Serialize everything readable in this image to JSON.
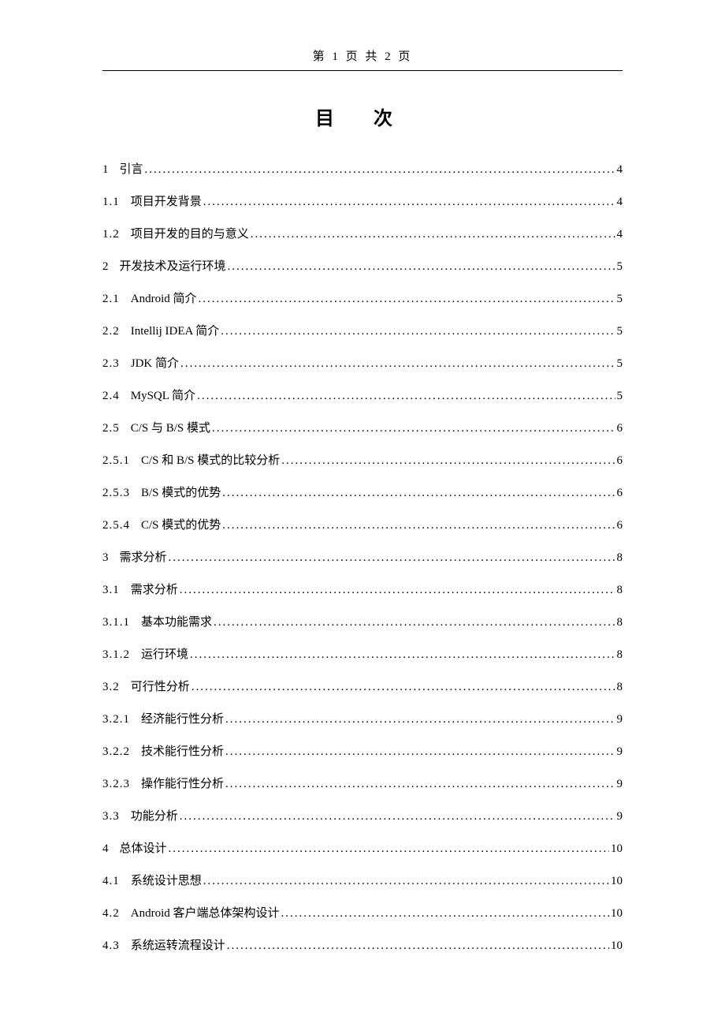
{
  "header": {
    "text": "第 1 页 共 2 页"
  },
  "title": "目  次",
  "toc": [
    {
      "level": 1,
      "num": "1",
      "label": "引言",
      "page": "4"
    },
    {
      "level": 2,
      "num": "1.1",
      "label": "项目开发背景",
      "page": "4"
    },
    {
      "level": 2,
      "num": "1.2",
      "label": "项目开发的目的与意义",
      "page": "4"
    },
    {
      "level": 1,
      "num": "2",
      "label": "开发技术及运行环境",
      "page": "5"
    },
    {
      "level": 2,
      "num": "2.1",
      "label": "Android 简介",
      "page": "5"
    },
    {
      "level": 2,
      "num": "2.2",
      "label": "Intellij IDEA 简介",
      "page": "5"
    },
    {
      "level": 2,
      "num": "2.3",
      "label": "JDK 简介",
      "page": "5"
    },
    {
      "level": 2,
      "num": "2.4",
      "label": "MySQL 简介",
      "page": "5"
    },
    {
      "level": 2,
      "num": "2.5",
      "label": "C/S 与 B/S 模式",
      "page": "6"
    },
    {
      "level": 3,
      "num": "2.5.1",
      "label": "C/S 和 B/S 模式的比较分析",
      "page": "6"
    },
    {
      "level": 3,
      "num": "2.5.3",
      "label": "B/S 模式的优势",
      "page": "6"
    },
    {
      "level": 3,
      "num": "2.5.4",
      "label": "C/S 模式的优势",
      "page": "6"
    },
    {
      "level": 1,
      "num": "3",
      "label": "需求分析",
      "page": "8"
    },
    {
      "level": 2,
      "num": "3.1",
      "label": "需求分析",
      "page": "8"
    },
    {
      "level": 3,
      "num": "3.1.1",
      "label": "基本功能需求",
      "page": "8"
    },
    {
      "level": 3,
      "num": "3.1.2",
      "label": "运行环境",
      "page": "8"
    },
    {
      "level": 2,
      "num": "3.2",
      "label": "可行性分析",
      "page": "8"
    },
    {
      "level": 3,
      "num": "3.2.1",
      "label": "经济能行性分析",
      "page": "9"
    },
    {
      "level": 3,
      "num": "3.2.2",
      "label": "技术能行性分析",
      "page": "9"
    },
    {
      "level": 3,
      "num": "3.2.3",
      "label": "操作能行性分析",
      "page": "9"
    },
    {
      "level": 2,
      "num": "3.3",
      "label": "功能分析",
      "page": "9"
    },
    {
      "level": 1,
      "num": "4",
      "label": "总体设计",
      "page": "10"
    },
    {
      "level": 2,
      "num": "4.1",
      "label": "系统设计思想",
      "page": "10"
    },
    {
      "level": 2,
      "num": "4.2",
      "label": "Android 客户端总体架构设计",
      "page": "10"
    },
    {
      "level": 2,
      "num": "4.3",
      "label": "系统运转流程设计",
      "page": "10"
    }
  ]
}
